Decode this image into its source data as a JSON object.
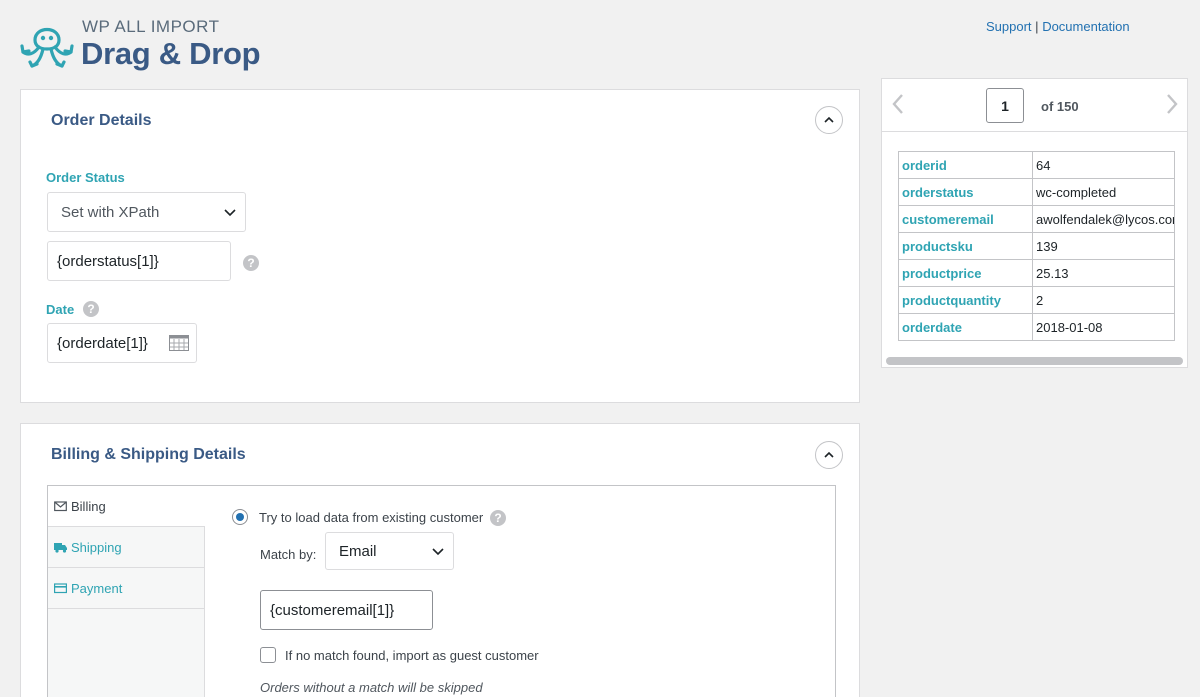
{
  "header": {
    "logo_subtitle": "WP ALL IMPORT",
    "logo_title": "Drag & Drop",
    "support_link": "Support",
    "link_separator": "|",
    "documentation_link": "Documentation"
  },
  "order_details": {
    "title": "Order Details",
    "order_status_label": "Order Status",
    "order_status_select": "Set with XPath",
    "order_status_value": "{orderstatus[1]}",
    "help_glyph": "?",
    "date_label": "Date",
    "date_value": "{orderdate[1]}"
  },
  "billing_shipping": {
    "title": "Billing & Shipping Details",
    "tabs": [
      {
        "label": "Billing",
        "icon": "envelope-icon"
      },
      {
        "label": "Shipping",
        "icon": "truck-icon"
      },
      {
        "label": "Payment",
        "icon": "credit-card-icon"
      }
    ],
    "load_existing_label": "Try to load data from existing customer",
    "match_by_label": "Match by:",
    "match_by_select": "Email",
    "match_value": "{customeremail[1]}",
    "guest_label": "If no match found, import as guest customer",
    "skip_note": "Orders without a match will be skipped"
  },
  "preview": {
    "current_page": "1",
    "total_label": "of 150",
    "rows": [
      {
        "key": "orderid",
        "value": "64"
      },
      {
        "key": "orderstatus",
        "value": "wc-completed"
      },
      {
        "key": "customeremail",
        "value": "awolfendalek@lycos.com"
      },
      {
        "key": "productsku",
        "value": "139"
      },
      {
        "key": "productprice",
        "value": "25.13"
      },
      {
        "key": "productquantity",
        "value": "2"
      },
      {
        "key": "orderdate",
        "value": "2018-01-08"
      }
    ]
  },
  "colors": {
    "accent_teal": "#2fa4b3",
    "heading_blue": "#3a5a85",
    "link_blue": "#2271b1"
  }
}
